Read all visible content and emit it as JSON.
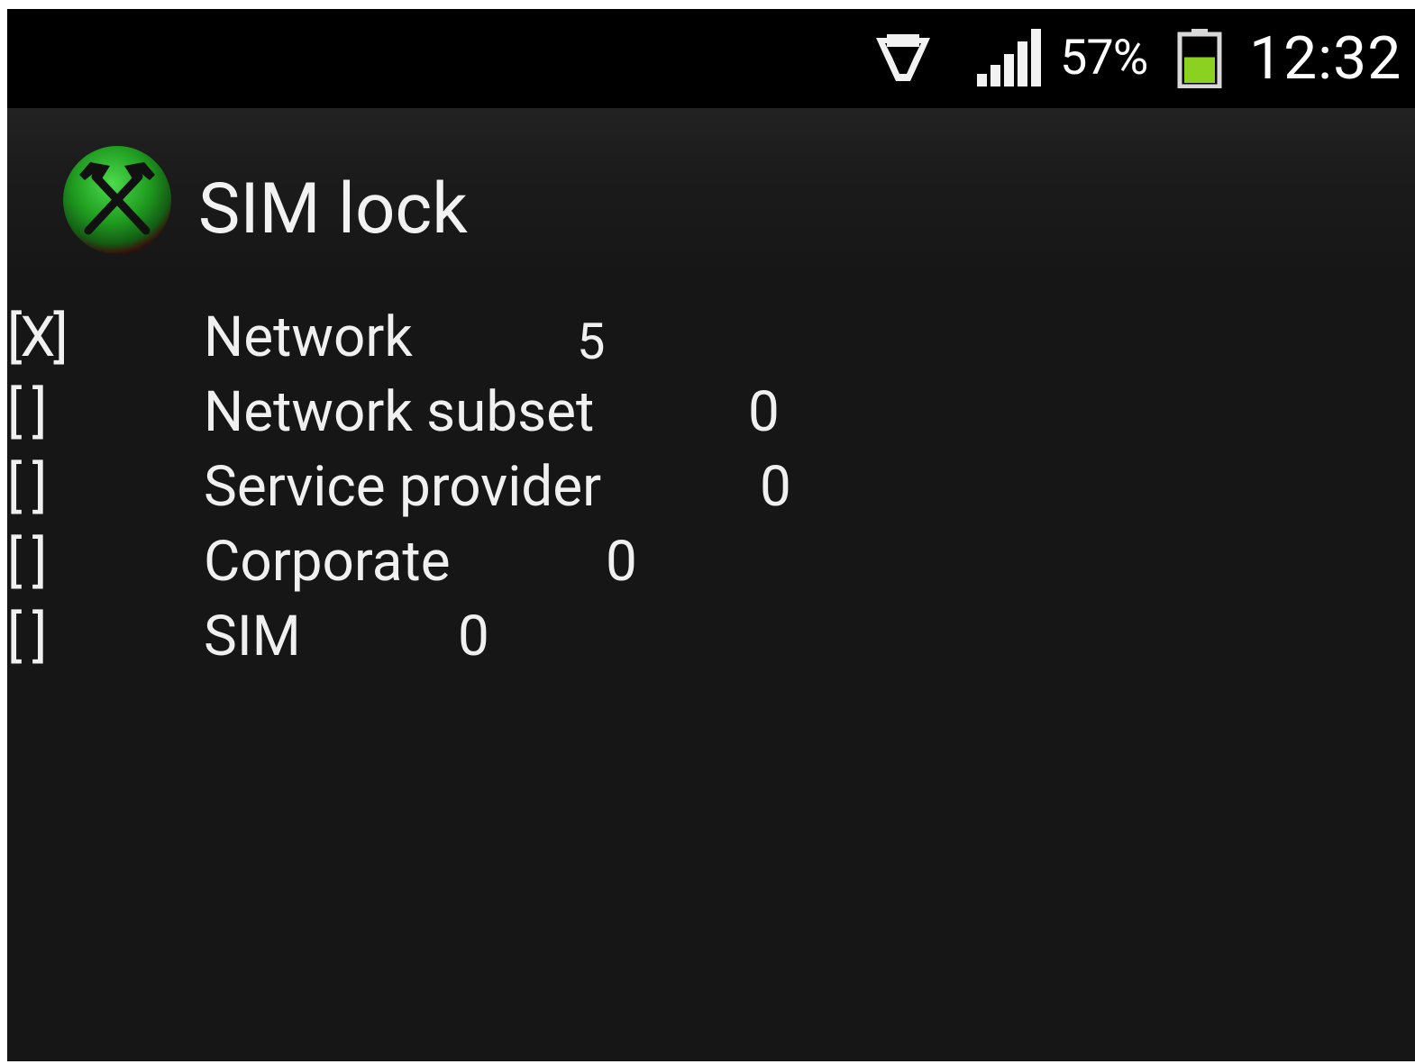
{
  "status_bar": {
    "usb_icon": "usb-debugging-icon",
    "signal_icon": "cell-signal-icon",
    "battery_percent": "57%",
    "battery_icon": "battery-icon",
    "battery_level": 0.57,
    "time": "12:32"
  },
  "header": {
    "logo_icon": "crossed-hammers-icon",
    "title": "SIM lock"
  },
  "locks": [
    {
      "checkbox": "[X]",
      "label": "Network",
      "value": "5"
    },
    {
      "checkbox": "[ ]",
      "label": "Network subset",
      "value": "0"
    },
    {
      "checkbox": "[ ]",
      "label": "Service provider",
      "value": "0"
    },
    {
      "checkbox": "[ ]",
      "label": "Corporate",
      "value": "0"
    },
    {
      "checkbox": "[ ]",
      "label": "SIM",
      "value": "0"
    }
  ],
  "colors": {
    "background": "#161616",
    "status_bar": "#000000",
    "text": "#f0f0f0",
    "logo_green": "#2fae2f",
    "battery_green": "#8bd120"
  }
}
